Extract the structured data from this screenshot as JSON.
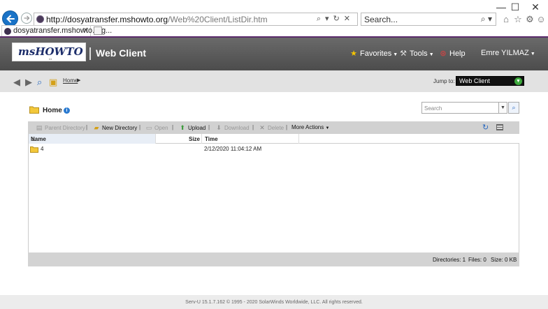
{
  "browser": {
    "url_host": "http://dosyatransfer.mshowto.org",
    "url_path": "/Web%20Client/ListDir.htm",
    "search_placeholder": "Search...",
    "tab_title": "dosyatransfer.mshowto.org...",
    "window_controls": [
      "—",
      "☐",
      "✕"
    ]
  },
  "app": {
    "logo_text": "msHOWTO",
    "title": "Web Client",
    "menu": {
      "favorites": "Favorites",
      "tools": "Tools",
      "help": "Help",
      "user": "Emre YILMAZ"
    }
  },
  "location": {
    "breadcrumb_home": "Home",
    "jump_label": "Jump to:",
    "jump_value": "Web Client"
  },
  "folder": {
    "title": "Home",
    "search_placeholder": "Search"
  },
  "toolbar": {
    "parent_directory": "Parent Directory",
    "new_directory": "New Directory",
    "open": "Open",
    "upload": "Upload",
    "download": "Download",
    "delete": "Delete",
    "more_actions": "More Actions"
  },
  "table": {
    "columns": {
      "name": "Name",
      "size": "Size",
      "time": "Time"
    },
    "rows": [
      {
        "name": "4",
        "size": "",
        "time": "2/12/2020 11:04:12 AM"
      }
    ]
  },
  "status": {
    "directories": "Directories: 1",
    "files": "Files: 0",
    "size": "Size: 0 KB"
  },
  "footer": {
    "text": "Serv-U 15.1.7.162 © 1995 - 2020 SolarWinds Worldwide, LLC. All rights reserved."
  },
  "colors": {
    "header_bg": "#555555",
    "accent_purple": "#5a2a6a",
    "back_button": "#1a73c7"
  }
}
